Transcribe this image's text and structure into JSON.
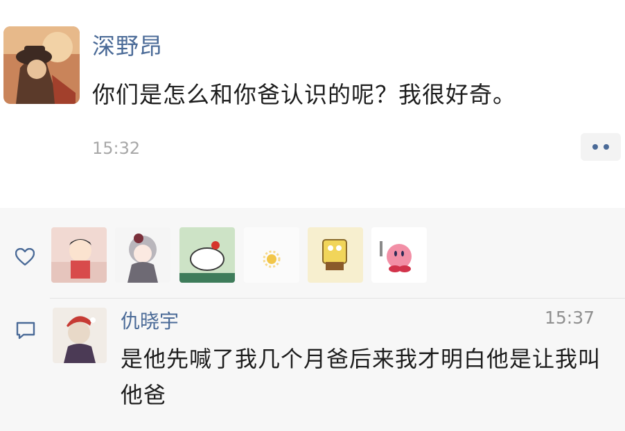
{
  "post": {
    "author": "深野昂",
    "text": "你们是怎么和你爸认识的呢？我很好奇。",
    "time": "15:32",
    "more_icon": "more-dots-icon"
  },
  "likes": {
    "icon": "heart-icon",
    "avatars": [
      {
        "name": "like-avatar-1"
      },
      {
        "name": "like-avatar-2"
      },
      {
        "name": "like-avatar-3"
      },
      {
        "name": "like-avatar-4"
      },
      {
        "name": "like-avatar-5"
      },
      {
        "name": "like-avatar-6"
      }
    ]
  },
  "comment": {
    "icon": "comment-icon",
    "author": "仇晓宇",
    "time": "15:37",
    "text": "是他先喊了我几个月爸后来我才明白他是让我叫他爸"
  },
  "colors": {
    "name_link": "#4a6a97",
    "text": "#1d1d1d",
    "time": "#a7a7a7",
    "section_bg": "#f7f7f7"
  }
}
